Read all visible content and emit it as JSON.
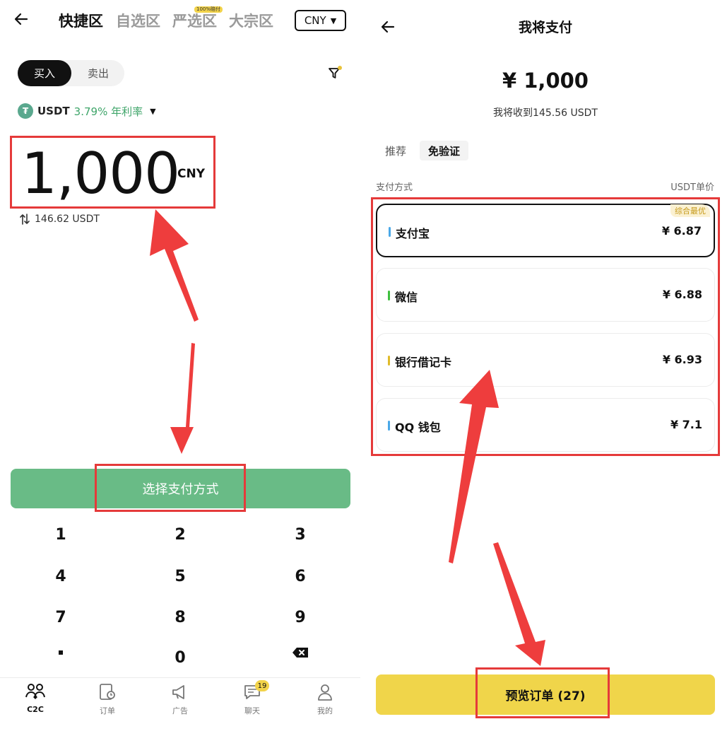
{
  "left": {
    "back_icon": "left-arrow-icon",
    "zone_tabs": [
      {
        "label": "快捷区",
        "active": true
      },
      {
        "label": "自选区",
        "active": false
      },
      {
        "label": "严选区",
        "active": false
      },
      {
        "label": "大宗区",
        "active": false
      }
    ],
    "zone_badge": "100%赔付",
    "currency_select": "CNY",
    "side_toggle": {
      "buy": "买入",
      "sell": "卖出"
    },
    "filter_icon": "filter-icon",
    "coin": {
      "logo": "₮",
      "name": "USDT",
      "rate": "3.79% 年利率"
    },
    "amount": {
      "value": "1,000",
      "unit": "CNY"
    },
    "conversion": "146.62 USDT",
    "pay_button": "选择支付方式",
    "keypad": [
      "1",
      "2",
      "3",
      "4",
      "5",
      "6",
      "7",
      "8",
      "9",
      "·",
      "0",
      "⌫"
    ],
    "nav": [
      {
        "label": "C2C",
        "icon": "people-icon",
        "active": true
      },
      {
        "label": "订单",
        "icon": "order-icon",
        "active": false
      },
      {
        "label": "广告",
        "icon": "megaphone-icon",
        "active": false
      },
      {
        "label": "聊天",
        "icon": "chat-icon",
        "active": false,
        "badge": "19"
      },
      {
        "label": "我的",
        "icon": "person-icon",
        "active": false
      }
    ]
  },
  "right": {
    "title": "我将支付",
    "amount": "¥ 1,000",
    "receive": "我将收到145.56 USDT",
    "tabs": {
      "recommend": "推荐",
      "no_verify": "免验证"
    },
    "col_method": "支付方式",
    "col_price": "USDT单价",
    "methods": [
      {
        "name": "支付宝",
        "price": "¥ 6.87",
        "color": "#4aa8e8",
        "tag": "综合最优"
      },
      {
        "name": "微信",
        "price": "¥ 6.88",
        "color": "#3fbf3f"
      },
      {
        "name": "银行借记卡",
        "price": "¥ 6.93",
        "color": "#e0bb2a"
      },
      {
        "name": "QQ 钱包",
        "price": "¥ 7.1",
        "color": "#4aa8e8"
      }
    ],
    "preview_button": "预览订单 (27)"
  },
  "colors": {
    "accent_green": "#69bb86",
    "accent_yellow": "#f0d54a",
    "highlight_red": "#e53a3a"
  }
}
